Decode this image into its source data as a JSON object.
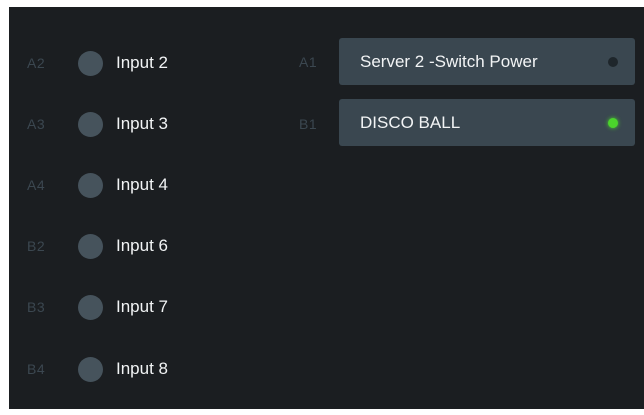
{
  "inputs": [
    {
      "port": "A2",
      "label": "Input 2"
    },
    {
      "port": "A3",
      "label": "Input 3"
    },
    {
      "port": "A4",
      "label": "Input 4"
    },
    {
      "port": "B2",
      "label": "Input 6"
    },
    {
      "port": "B3",
      "label": "Input 7"
    },
    {
      "port": "B4",
      "label": "Input 8"
    }
  ],
  "outputs": [
    {
      "port": "A1",
      "label": "Server 2 -Switch Power",
      "state": "off",
      "indicator_color": "#1e262b"
    },
    {
      "port": "B1",
      "label": "DISCO BALL",
      "state": "on",
      "indicator_color": "#4bd42c"
    }
  ],
  "colors": {
    "background": "#1b1e21",
    "button": "#3a4750",
    "dot": "#46535c",
    "port_text": "#3b4750",
    "label_text": "#f2f4f5",
    "led_on": "#4bd42c"
  }
}
